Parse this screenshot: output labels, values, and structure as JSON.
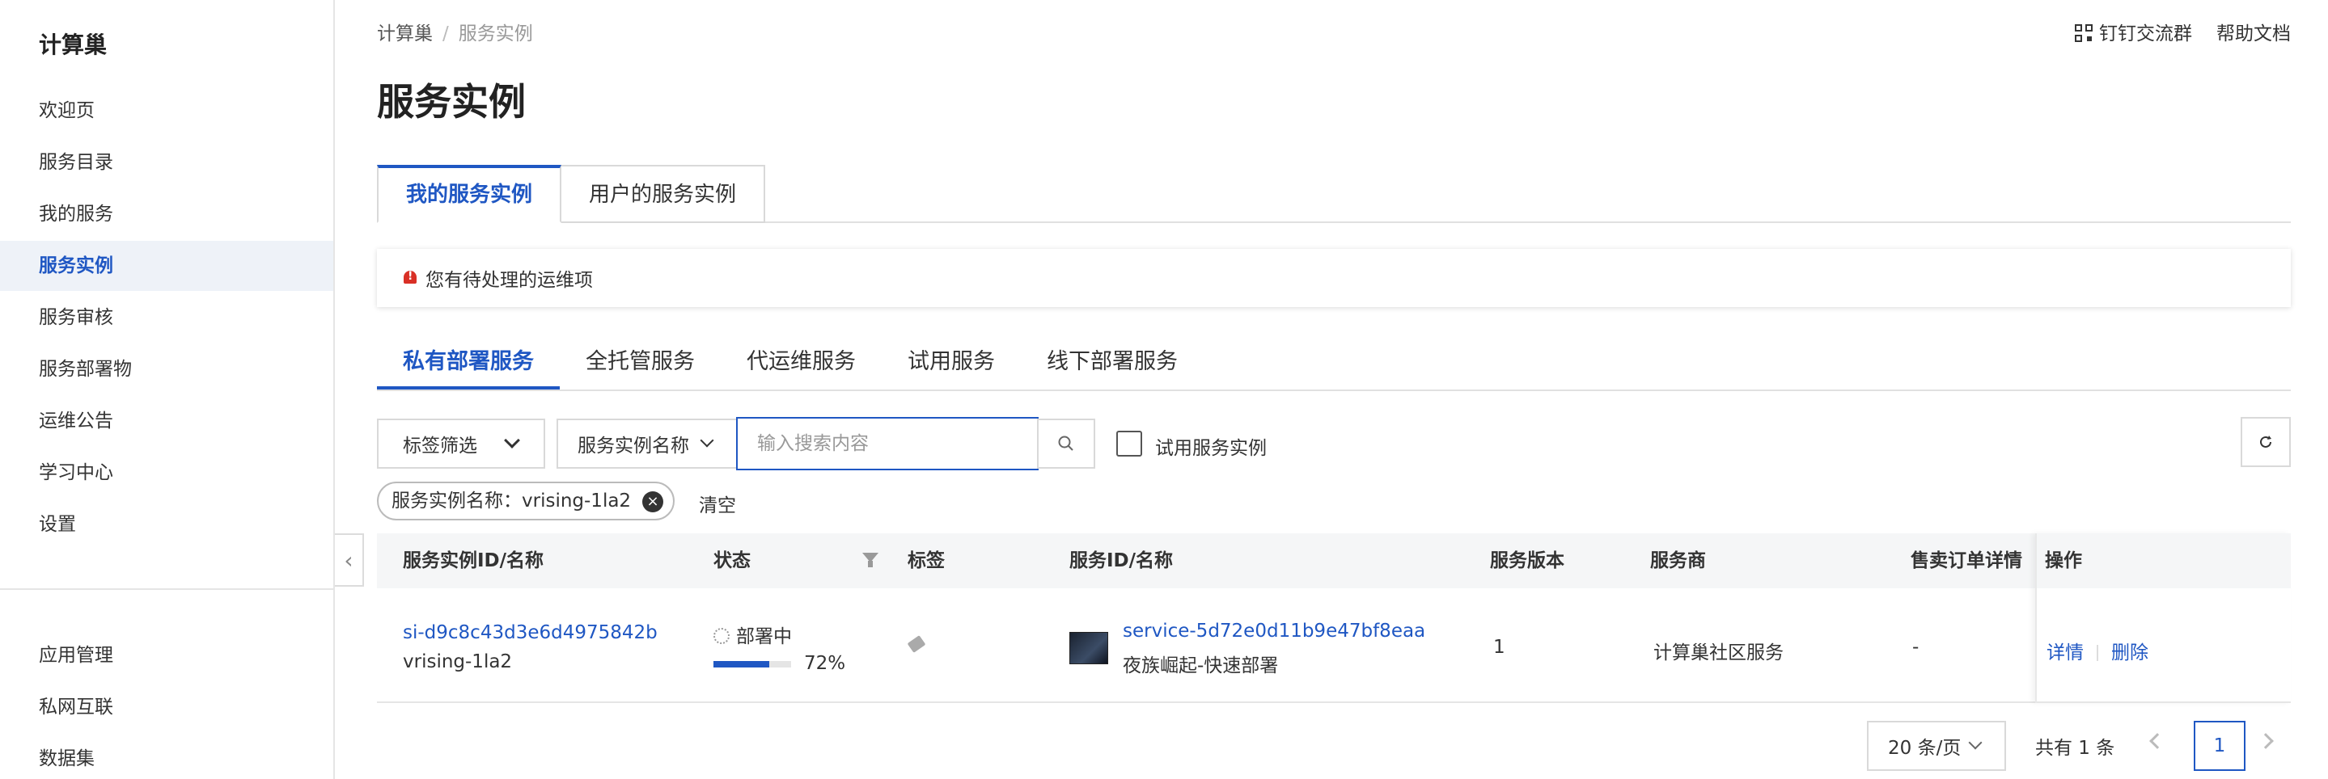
{
  "sidebar": {
    "brand": "计算巢",
    "items": [
      {
        "label": "欢迎页"
      },
      {
        "label": "服务目录"
      },
      {
        "label": "我的服务"
      },
      {
        "label": "服务实例",
        "active": true
      },
      {
        "label": "服务审核"
      },
      {
        "label": "服务部署物"
      },
      {
        "label": "运维公告"
      },
      {
        "label": "学习中心"
      },
      {
        "label": "设置"
      }
    ],
    "bottom_items": [
      {
        "label": "应用管理"
      },
      {
        "label": "私网互联"
      },
      {
        "label": "数据集"
      }
    ]
  },
  "breadcrumb": {
    "root": "计算巢",
    "separator": "/",
    "current": "服务实例"
  },
  "top_links": {
    "dingtalk": "钉钉交流群",
    "help": "帮助文档"
  },
  "page_title": "服务实例",
  "primary_tabs": [
    {
      "label": "我的服务实例",
      "active": true
    },
    {
      "label": "用户的服务实例"
    }
  ],
  "notice": {
    "text": "您有待处理的运维项"
  },
  "secondary_tabs": [
    {
      "label": "私有部署服务",
      "active": true
    },
    {
      "label": "全托管服务"
    },
    {
      "label": "代运维服务"
    },
    {
      "label": "试用服务"
    },
    {
      "label": "线下部署服务"
    }
  ],
  "filters": {
    "tag_filter": "标签筛选",
    "field_select": "服务实例名称",
    "search_placeholder": "输入搜索内容",
    "trial_checkbox": "试用服务实例",
    "active_tag": "服务实例名称：vrising-1la2",
    "clear": "清空"
  },
  "table": {
    "columns": [
      "服务实例ID/名称",
      "状态",
      "标签",
      "服务ID/名称",
      "服务版本",
      "服务商",
      "售卖订单详情",
      "操作"
    ],
    "rows": [
      {
        "instance_id": "si-d9c8c43d3e6d4975842b",
        "instance_name": "vrising-1la2",
        "status": "部署中",
        "progress": "72%",
        "progress_value": 0.72,
        "service_id": "service-5d72e0d11b9e47bf8eaa",
        "service_name": "夜族崛起-快速部署",
        "version": "1",
        "provider": "计算巢社区服务",
        "order_detail": "-",
        "actions": {
          "detail": "详情",
          "delete": "删除"
        }
      }
    ]
  },
  "pagination": {
    "page_size": "20 条/页",
    "total": "共有 1 条",
    "current_page": "1"
  },
  "colors": {
    "accent": "#1f57c3",
    "alert": "#d93026"
  }
}
